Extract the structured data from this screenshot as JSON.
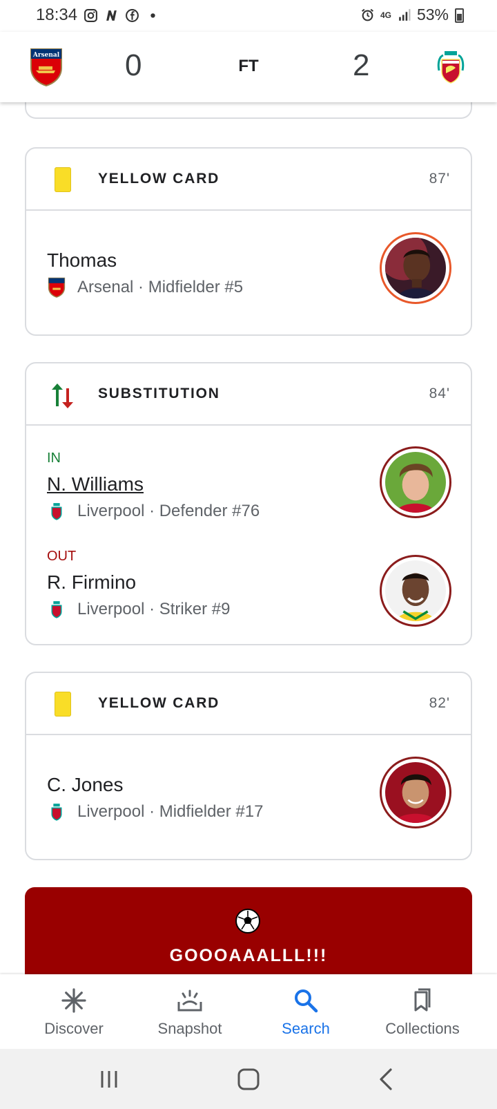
{
  "status_bar": {
    "time": "18:34",
    "network": "4G",
    "battery": "53%"
  },
  "match": {
    "home_team": "Arsenal",
    "away_team": "Liverpool",
    "home_score": "0",
    "away_score": "2",
    "status": "FT"
  },
  "events": [
    {
      "type": "YELLOW CARD",
      "minute": "87'",
      "player": "Thomas",
      "meta": "Arsenal · Midfielder #5",
      "team": "Arsenal"
    },
    {
      "type": "SUBSTITUTION",
      "minute": "84'",
      "in_label": "IN",
      "in_player": "N. Williams",
      "in_meta": "Liverpool · Defender #76",
      "out_label": "OUT",
      "out_player": "R. Firmino",
      "out_meta": "Liverpool · Striker #9"
    },
    {
      "type": "YELLOW CARD",
      "minute": "82'",
      "player": "C. Jones",
      "meta": "Liverpool · Midfielder #17",
      "team": "Liverpool"
    }
  ],
  "goal": {
    "text": "GOOOAAALLL!!!"
  },
  "bottom_nav": {
    "items": [
      {
        "label": "Discover",
        "icon": "discover-asterisk-icon"
      },
      {
        "label": "Snapshot",
        "icon": "snapshot-icon"
      },
      {
        "label": "Search",
        "icon": "search-icon",
        "active": true
      },
      {
        "label": "Collections",
        "icon": "collections-bookmark-icon"
      }
    ]
  },
  "colors": {
    "accent": "#1a73e8",
    "goal_banner": "#990000",
    "in_green": "#188038",
    "out_red": "#a50e0e",
    "yellow_card": "#f9dd27"
  }
}
